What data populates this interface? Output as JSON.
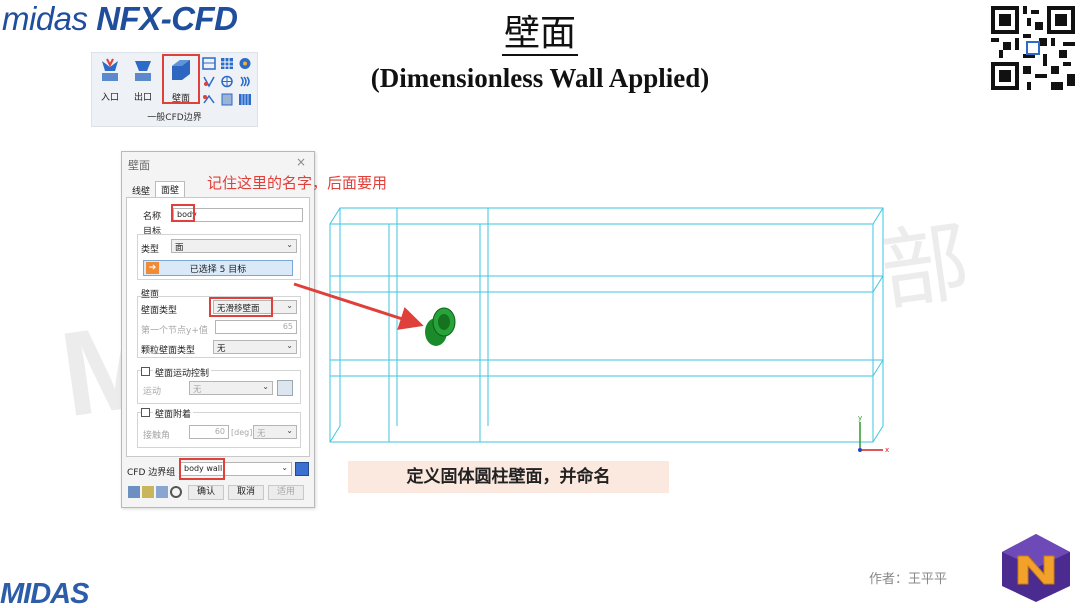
{
  "brand": {
    "name": "midas NFX-CFD",
    "prefix": "midas",
    "product": "NFX-CFD"
  },
  "title": {
    "cn": "壁面",
    "en": "(Dimensionless Wall Applied)"
  },
  "watermark": {
    "left": "M",
    "right": "部"
  },
  "ribbon": {
    "buttons": [
      {
        "label": "入口",
        "icon": "inlet-icon"
      },
      {
        "label": "出口",
        "icon": "outlet-icon"
      },
      {
        "label": "壁面",
        "icon": "wall-icon",
        "highlighted": true
      }
    ],
    "group_label": "一般CFD边界"
  },
  "dialog": {
    "title": "壁面",
    "tabs": [
      {
        "label": "线壁",
        "active": false
      },
      {
        "label": "面壁",
        "active": true
      }
    ],
    "name_label": "名称",
    "name_value": "body",
    "target_section": "目标",
    "type_label": "类型",
    "type_value": "面",
    "selection_button": "已选择 5 目标",
    "wall_section": "壁面",
    "wall_type_label": "壁面类型",
    "wall_type_value": "无滑移壁面",
    "first_node_label": "第一个节点y+值",
    "first_node_value": "65",
    "particle_label": "颗粒壁面类型",
    "particle_value": "无",
    "motion_check": "壁面运动控制",
    "motion_label": "运动",
    "motion_value": "无",
    "attach_check": "壁面附着",
    "contact_label": "接触角",
    "contact_value": "60",
    "contact_unit": "[deg]",
    "contact_combo": "无",
    "boundary_group_label": "CFD 边界组",
    "boundary_group_value": "body wall",
    "buttons": {
      "ok": "确认",
      "cancel": "取消",
      "apply": "适用"
    }
  },
  "annotation": "记住这里的名字，后面要用",
  "caption": "定义固体圆柱壁面，并命名",
  "axes": {
    "x": "x",
    "y": "y"
  },
  "colors": {
    "accent_red": "#e0403a",
    "wireframe": "#3ec6e0",
    "cylinder": "#1a8a2a",
    "brand_blue": "#1f4e9c"
  },
  "footer": {
    "author": "作者：王平平",
    "logo": "MIDAS"
  }
}
